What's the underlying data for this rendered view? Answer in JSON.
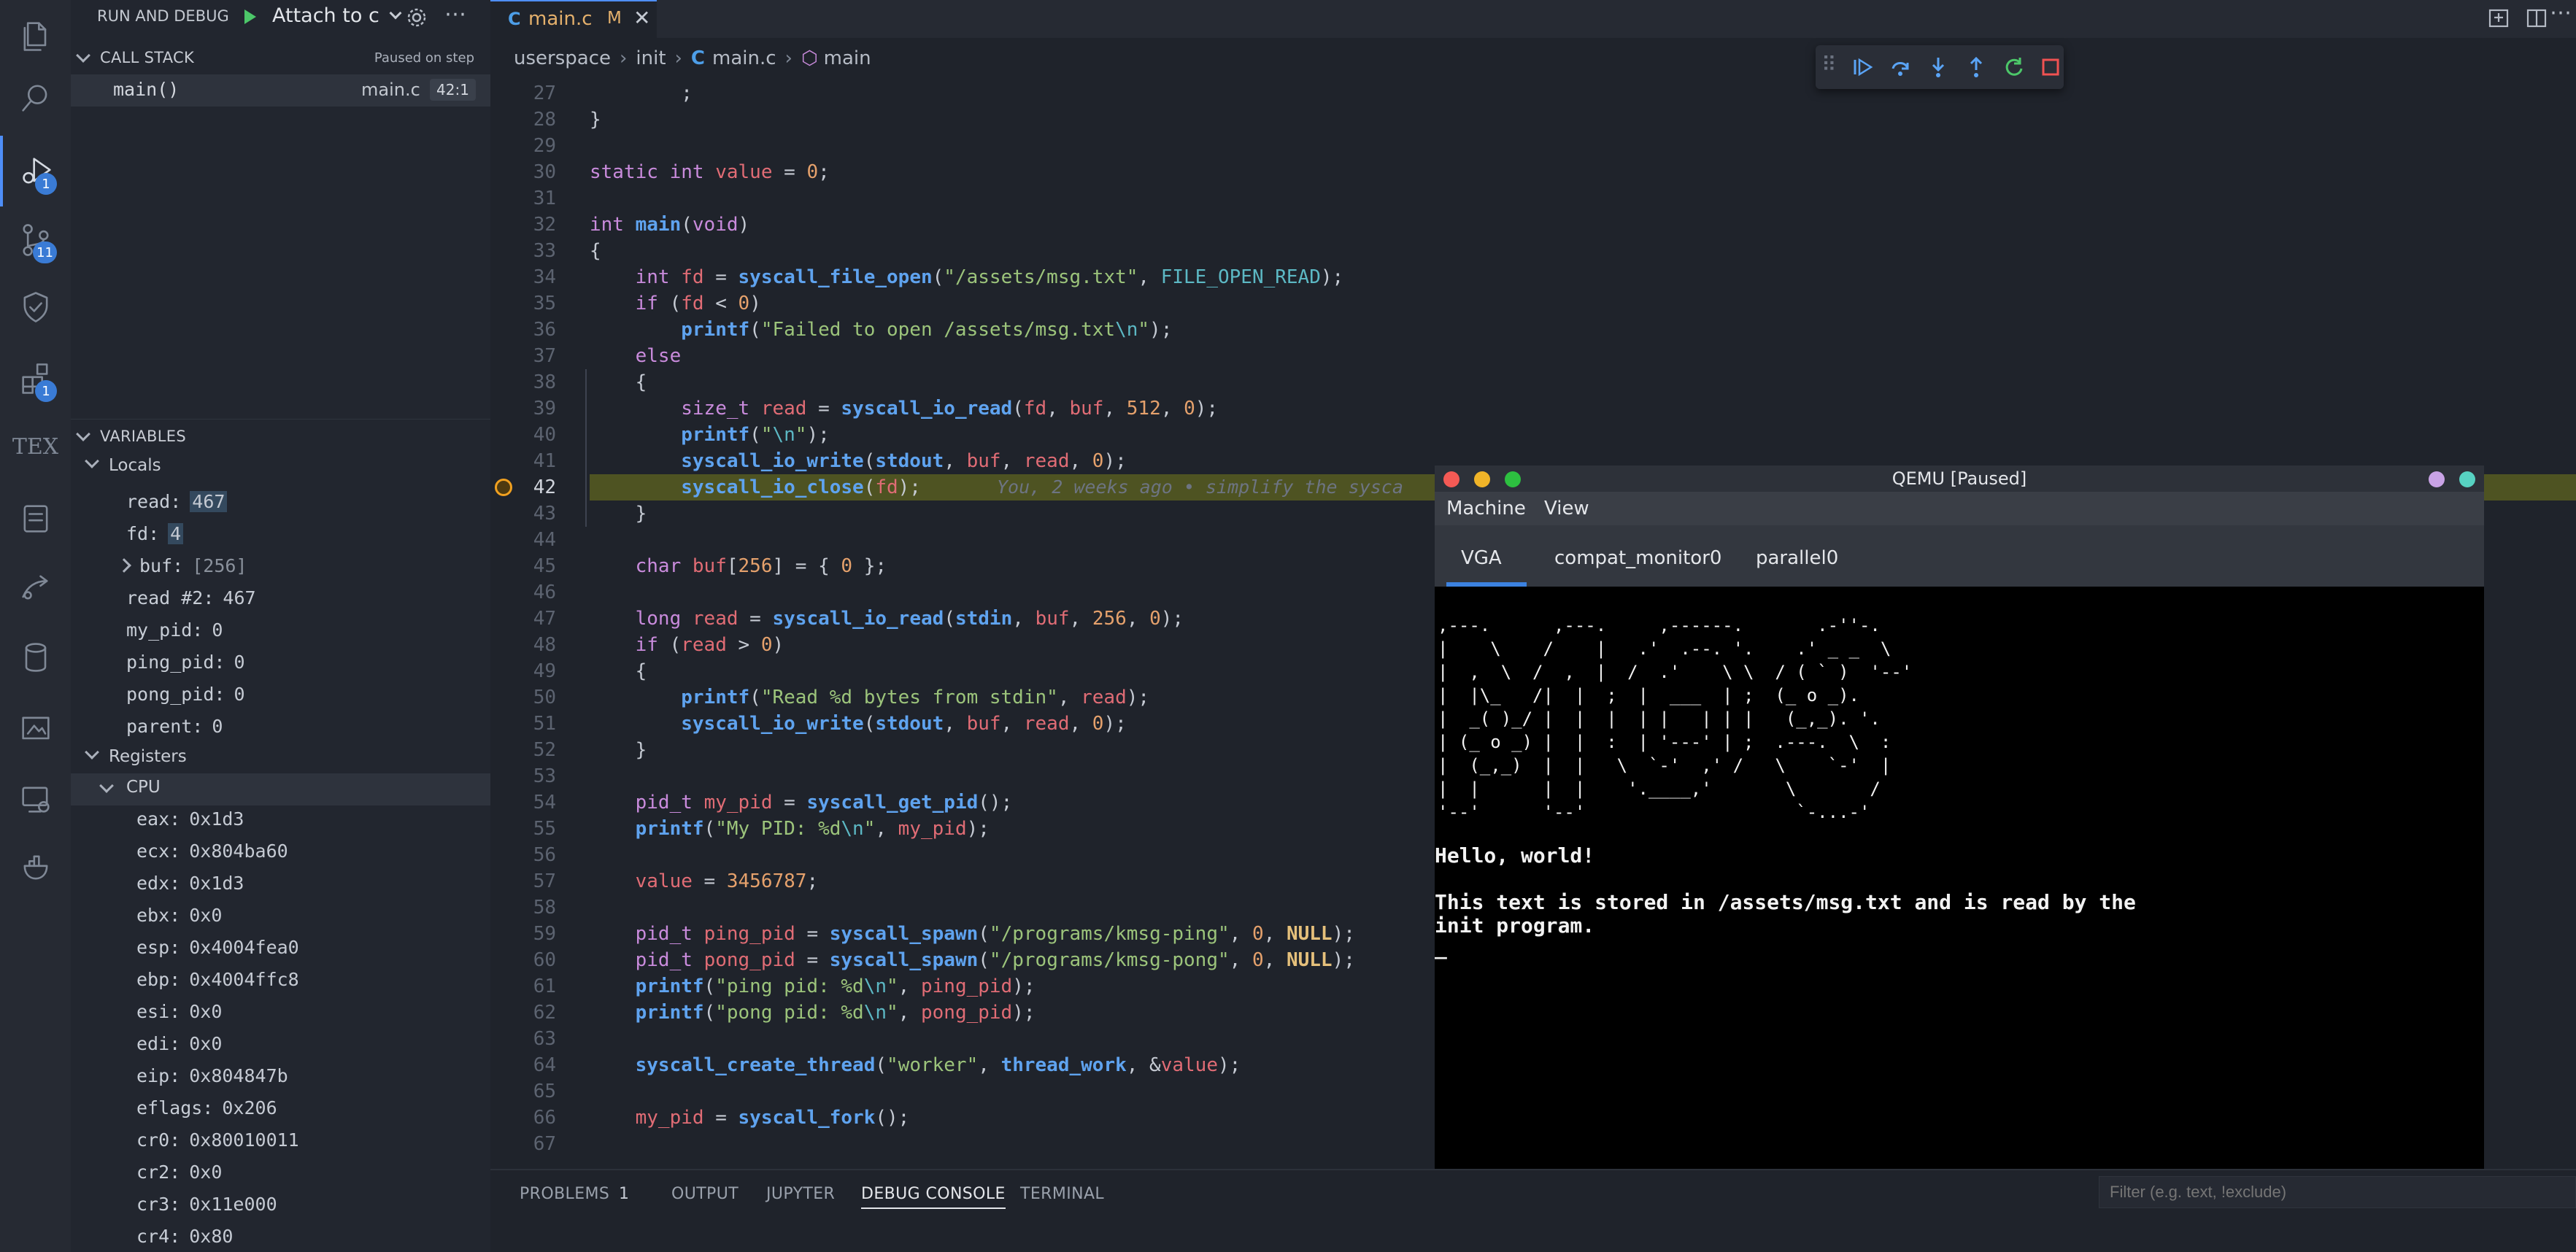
{
  "activity_bar": {
    "run_badge": "1",
    "scm_badge": "11",
    "extensions_badge": "1",
    "tex_label": "TEX"
  },
  "run_debug": {
    "title": "RUN AND DEBUG",
    "config": "Attach to c"
  },
  "call_stack": {
    "title": "CALL STACK",
    "status": "Paused on step",
    "frame_name": "main()",
    "frame_file": "main.c",
    "frame_pos": "42:1"
  },
  "variables": {
    "title": "VARIABLES",
    "locals_label": "Locals",
    "locals": [
      {
        "name": "read:",
        "value": "467",
        "highlight": true
      },
      {
        "name": "fd:",
        "value": "4",
        "highlight": true
      },
      {
        "name": "buf:",
        "value": "[256]",
        "expandable": true
      },
      {
        "name": "read #2:",
        "value": "467"
      },
      {
        "name": "my_pid:",
        "value": "0"
      },
      {
        "name": "ping_pid:",
        "value": "0"
      },
      {
        "name": "pong_pid:",
        "value": "0"
      },
      {
        "name": "parent:",
        "value": "0"
      }
    ],
    "registers_label": "Registers",
    "cpu_label": "CPU",
    "registers": [
      {
        "name": "eax:",
        "value": "0x1d3"
      },
      {
        "name": "ecx:",
        "value": "0x804ba60"
      },
      {
        "name": "edx:",
        "value": "0x1d3"
      },
      {
        "name": "ebx:",
        "value": "0x0"
      },
      {
        "name": "esp:",
        "value": "0x4004fea0"
      },
      {
        "name": "ebp:",
        "value": "0x4004ffc8"
      },
      {
        "name": "esi:",
        "value": "0x0"
      },
      {
        "name": "edi:",
        "value": "0x0"
      },
      {
        "name": "eip:",
        "value": "0x804847b"
      },
      {
        "name": "eflags:",
        "value": "0x206"
      },
      {
        "name": "cr0:",
        "value": "0x80010011"
      },
      {
        "name": "cr2:",
        "value": "0x0"
      },
      {
        "name": "cr3:",
        "value": "0x11e000"
      },
      {
        "name": "cr4:",
        "value": "0x80"
      }
    ]
  },
  "editor": {
    "tab_name": "main.c",
    "tab_status": "M",
    "breadcrumb": [
      "userspace",
      "init",
      "main.c",
      "main"
    ],
    "current_line": "42",
    "blame": "You, 2 weeks ago • simplify the sysca",
    "lines": [
      {
        "n": "27",
        "code": "        ;"
      },
      {
        "n": "28",
        "code": "}"
      },
      {
        "n": "29",
        "code": ""
      },
      {
        "n": "30",
        "code": "static int value = 0;"
      },
      {
        "n": "31",
        "code": ""
      },
      {
        "n": "32",
        "code": "int main(void)"
      },
      {
        "n": "33",
        "code": "{"
      },
      {
        "n": "34",
        "code": "    int fd = syscall_file_open(\"/assets/msg.txt\", FILE_OPEN_READ);"
      },
      {
        "n": "35",
        "code": "    if (fd < 0)"
      },
      {
        "n": "36",
        "code": "        printf(\"Failed to open /assets/msg.txt\\n\");"
      },
      {
        "n": "37",
        "code": "    else"
      },
      {
        "n": "38",
        "code": "    {"
      },
      {
        "n": "39",
        "code": "        size_t read = syscall_io_read(fd, buf, 512, 0);"
      },
      {
        "n": "40",
        "code": "        printf(\"\\n\");"
      },
      {
        "n": "41",
        "code": "        syscall_io_write(stdout, buf, read, 0);"
      },
      {
        "n": "42",
        "code": "        syscall_io_close(fd);"
      },
      {
        "n": "43",
        "code": "    }"
      },
      {
        "n": "44",
        "code": ""
      },
      {
        "n": "45",
        "code": "    char buf[256] = { 0 };"
      },
      {
        "n": "46",
        "code": ""
      },
      {
        "n": "47",
        "code": "    long read = syscall_io_read(stdin, buf, 256, 0);"
      },
      {
        "n": "48",
        "code": "    if (read > 0)"
      },
      {
        "n": "49",
        "code": "    {"
      },
      {
        "n": "50",
        "code": "        printf(\"Read %d bytes from stdin\", read);"
      },
      {
        "n": "51",
        "code": "        syscall_io_write(stdout, buf, read, 0);"
      },
      {
        "n": "52",
        "code": "    }"
      },
      {
        "n": "53",
        "code": ""
      },
      {
        "n": "54",
        "code": "    pid_t my_pid = syscall_get_pid();"
      },
      {
        "n": "55",
        "code": "    printf(\"My PID: %d\\n\", my_pid);"
      },
      {
        "n": "56",
        "code": ""
      },
      {
        "n": "57",
        "code": "    value = 3456787;"
      },
      {
        "n": "58",
        "code": ""
      },
      {
        "n": "59",
        "code": "    pid_t ping_pid = syscall_spawn(\"/programs/kmsg-ping\", 0, NULL);"
      },
      {
        "n": "60",
        "code": "    pid_t pong_pid = syscall_spawn(\"/programs/kmsg-pong\", 0, NULL);"
      },
      {
        "n": "61",
        "code": "    printf(\"ping pid: %d\\n\", ping_pid);"
      },
      {
        "n": "62",
        "code": "    printf(\"pong pid: %d\\n\", pong_pid);"
      },
      {
        "n": "63",
        "code": ""
      },
      {
        "n": "64",
        "code": "    syscall_create_thread(\"worker\", thread_work, &value);"
      },
      {
        "n": "65",
        "code": ""
      },
      {
        "n": "66",
        "code": "    my_pid = syscall_fork();"
      },
      {
        "n": "67",
        "code": ""
      }
    ]
  },
  "qemu": {
    "title": "QEMU [Paused]",
    "menu": [
      "Machine",
      "View"
    ],
    "tabs": [
      "VGA",
      "compat_monitor0",
      "parallel0"
    ],
    "ascii_art": [
      ",---.      ,---.     ,------.       .-''-.",
      "|    \\    /    |   .'  .--. '.    .' _ _  \\",
      "|  ,  \\  /  ,  |  /  .'    \\ \\  / ( ` )  '--'",
      "|  |\\_   /|  |  ;  |  ___  | ;  (_ o _).",
      "|  _( )_/ |  |  |  | |   | | |   (_,_). '.",
      "| (_ o _) |  |  :  | '---' | ;  .---.  \\  :",
      "|  (_,_)  |  |   \\  `-'  ,' /   \\    `-'  |",
      "|  |      |  |    '.____,'       \\       /",
      "'--'      '--'                    `-...-'"
    ],
    "hello": "Hello, world!",
    "msg_line1": "This text is stored in /assets/msg.txt and is read by the",
    "msg_line2": "init program.",
    "cursor": "_"
  },
  "panel": {
    "tabs": [
      "PROBLEMS",
      "OUTPUT",
      "JUPYTER",
      "DEBUG CONSOLE",
      "TERMINAL"
    ],
    "problems_count": "1",
    "active_tab": "DEBUG CONSOLE",
    "filter_placeholder": "Filter (e.g. text, !exclude)"
  }
}
